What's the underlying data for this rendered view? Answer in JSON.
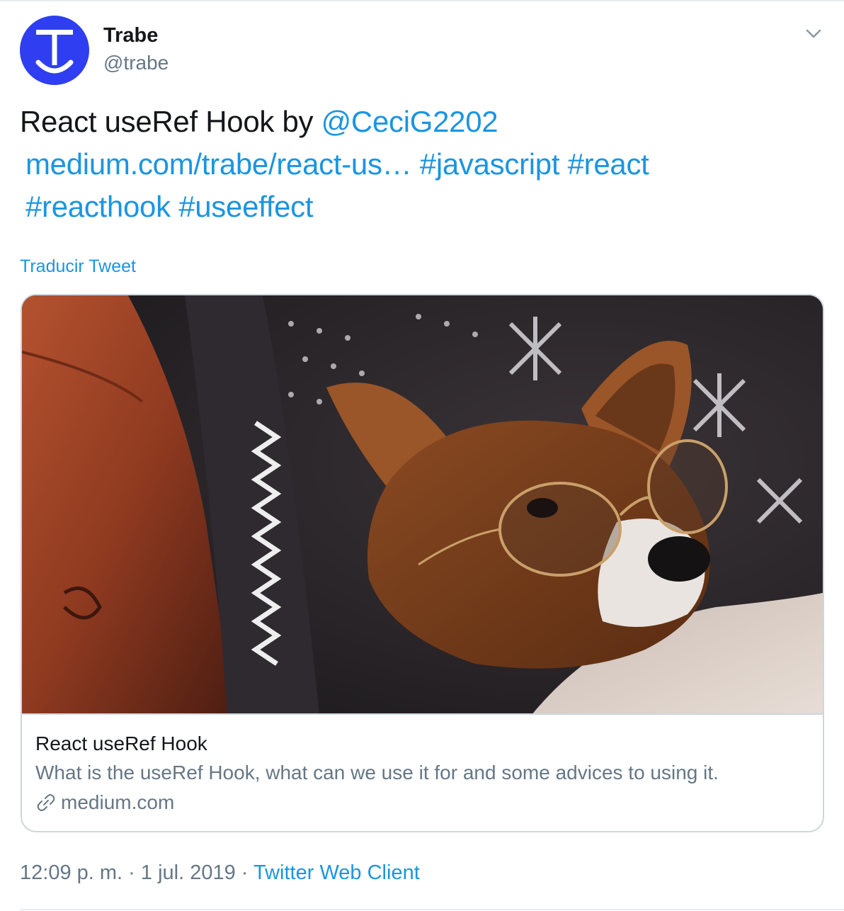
{
  "author": {
    "name": "Trabe",
    "handle": "@trabe",
    "avatar_letter": "T",
    "avatar_color": "#2f3ef0"
  },
  "tweet": {
    "text_prefix": "React useRef Hook by ",
    "mention": "@CeciG2202",
    "link": "medium.com/trabe/react-us…",
    "hashtags": [
      "#javascript",
      "#react",
      "#reacthook",
      "#useeffect"
    ]
  },
  "translate_label": "Traducir Tweet",
  "card": {
    "image_alt": "Corgi wearing glasses under a patterned blanket",
    "title": "React useRef Hook",
    "description": "What is the useRef Hook, what can we use it for and some advices to using it.",
    "domain": "medium.com"
  },
  "meta": {
    "time": "12:09 p. m.",
    "separator": "·",
    "date": "1 jul. 2019",
    "client": "Twitter Web Client"
  },
  "icons": {
    "caret": "chevron-down-icon",
    "card_link": "link-icon"
  },
  "colors": {
    "link": "#1b95e0",
    "secondary": "#657786",
    "border": "#ccd6dd"
  }
}
